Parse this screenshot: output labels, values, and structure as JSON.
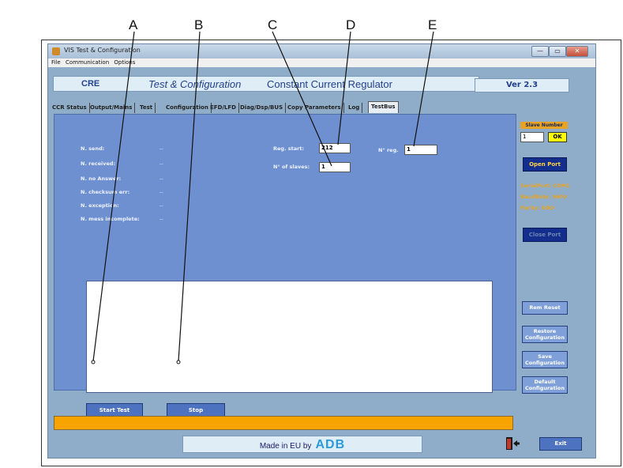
{
  "callouts": [
    "A",
    "B",
    "C",
    "D",
    "E"
  ],
  "window": {
    "title": "VIS Test & Configuration",
    "buttons": {
      "minimize": "—",
      "maximize": "▭",
      "close": "✕"
    }
  },
  "menu": [
    "File",
    "Communication",
    "Options"
  ],
  "header": {
    "cre": "CRE",
    "title_italic": "Test & Configuration",
    "title_rest": "Constant Current Regulator",
    "version": "Ver 2.3"
  },
  "tabs": [
    "CCR Status",
    "Output/Mains",
    "Test",
    "Configuration",
    "EFD/LFD",
    "Diag/Dsp/BUS",
    "Copy Parameters",
    "Log",
    "TestBus"
  ],
  "panel": {
    "stats": [
      {
        "label": "N. send:",
        "value": "--"
      },
      {
        "label": "N. received:",
        "value": "--"
      },
      {
        "label": "N. no Answer:",
        "value": "--"
      },
      {
        "label": "N. checksum err:",
        "value": "--"
      },
      {
        "label": "N. exception:",
        "value": "--"
      },
      {
        "label": "N. mess incomplete:",
        "value": "--"
      }
    ],
    "reg_start": {
      "label": "Reg. start:",
      "value": "212"
    },
    "n_reg": {
      "label": "N° reg.",
      "value": "1"
    },
    "n_slaves": {
      "label": "N° of slaves:",
      "value": "1"
    },
    "start_test": "Start Test",
    "stop": "Stop"
  },
  "side": {
    "slave_number_label": "Slave Number",
    "slave_number_value": "1",
    "ok": "OK",
    "open_port": "Open Port",
    "status_lines": [
      "SerialPort: COM1",
      "BaudRate: 9600",
      "Parity: ODD"
    ],
    "close_port": "Close Port",
    "rem_reset": "Rem Reset",
    "restore": [
      "Restore",
      "Configuration"
    ],
    "save": [
      "Save",
      "Configuration"
    ],
    "default": [
      "Default",
      "Configuration"
    ]
  },
  "footer": {
    "made_in": "Made in EU by",
    "brand": "ADB",
    "exit": "Exit"
  },
  "colors": {
    "window_bg": "#8fadc8",
    "panel_bg": "#6e90d0",
    "status_bar": "#f7a400",
    "accent_text": "#23408c"
  }
}
